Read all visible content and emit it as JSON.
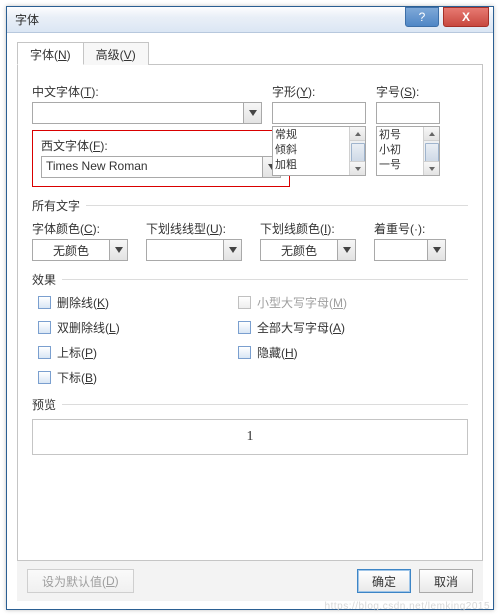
{
  "window": {
    "title": "字体"
  },
  "titlebar_buttons": {
    "help": "?",
    "close": "X"
  },
  "tabs": {
    "font": {
      "text": "字体(",
      "key": "N",
      "suffix": ")"
    },
    "adv": {
      "text": "高级(",
      "key": "V",
      "suffix": ")"
    }
  },
  "labels": {
    "cn_font": {
      "text": "中文字体(",
      "key": "T",
      "suffix": "):"
    },
    "style": {
      "text": "字形(",
      "key": "Y",
      "suffix": "):"
    },
    "size": {
      "text": "字号(",
      "key": "S",
      "suffix": "):"
    },
    "west_font": {
      "text": "西文字体(",
      "key": "F",
      "suffix": "):"
    },
    "all_text": "所有文字",
    "font_color": {
      "text": "字体颜色(",
      "key": "C",
      "suffix": "):"
    },
    "underline_style": {
      "text": "下划线线型(",
      "key": "U",
      "suffix": "):"
    },
    "underline_color": {
      "text": "下划线颜色(",
      "key": "I",
      "suffix": "):"
    },
    "emphasis": {
      "text": "着重号(·",
      "key": "",
      "suffix": "):"
    },
    "effects": "效果",
    "preview": "预览"
  },
  "values": {
    "cn_font": "",
    "west_font": "Times New Roman",
    "style": "",
    "size": "",
    "font_color": "无颜色",
    "underline_style": "",
    "underline_color": "无颜色",
    "emphasis": ""
  },
  "style_options": [
    "常规",
    "倾斜",
    "加粗"
  ],
  "size_options": [
    "初号",
    "小初",
    "一号"
  ],
  "effects_left": [
    {
      "text": "删除线(",
      "key": "K",
      "suffix": ")"
    },
    {
      "text": "双删除线(",
      "key": "L",
      "suffix": ")"
    },
    {
      "text": "上标(",
      "key": "P",
      "suffix": ")"
    },
    {
      "text": "下标(",
      "key": "B",
      "suffix": ")"
    }
  ],
  "effects_right": [
    {
      "text": "小型大写字母(",
      "key": "M",
      "suffix": ")",
      "disabled": true
    },
    {
      "text": "全部大写字母(",
      "key": "A",
      "suffix": ")"
    },
    {
      "text": "隐藏(",
      "key": "H",
      "suffix": ")"
    }
  ],
  "preview_text": "1",
  "buttons": {
    "set_default": {
      "text": "设为默认值(",
      "key": "D",
      "suffix": ")"
    },
    "ok": "确定",
    "cancel": "取消"
  },
  "watermark": "https://blog.csdn.net/lemking2015"
}
